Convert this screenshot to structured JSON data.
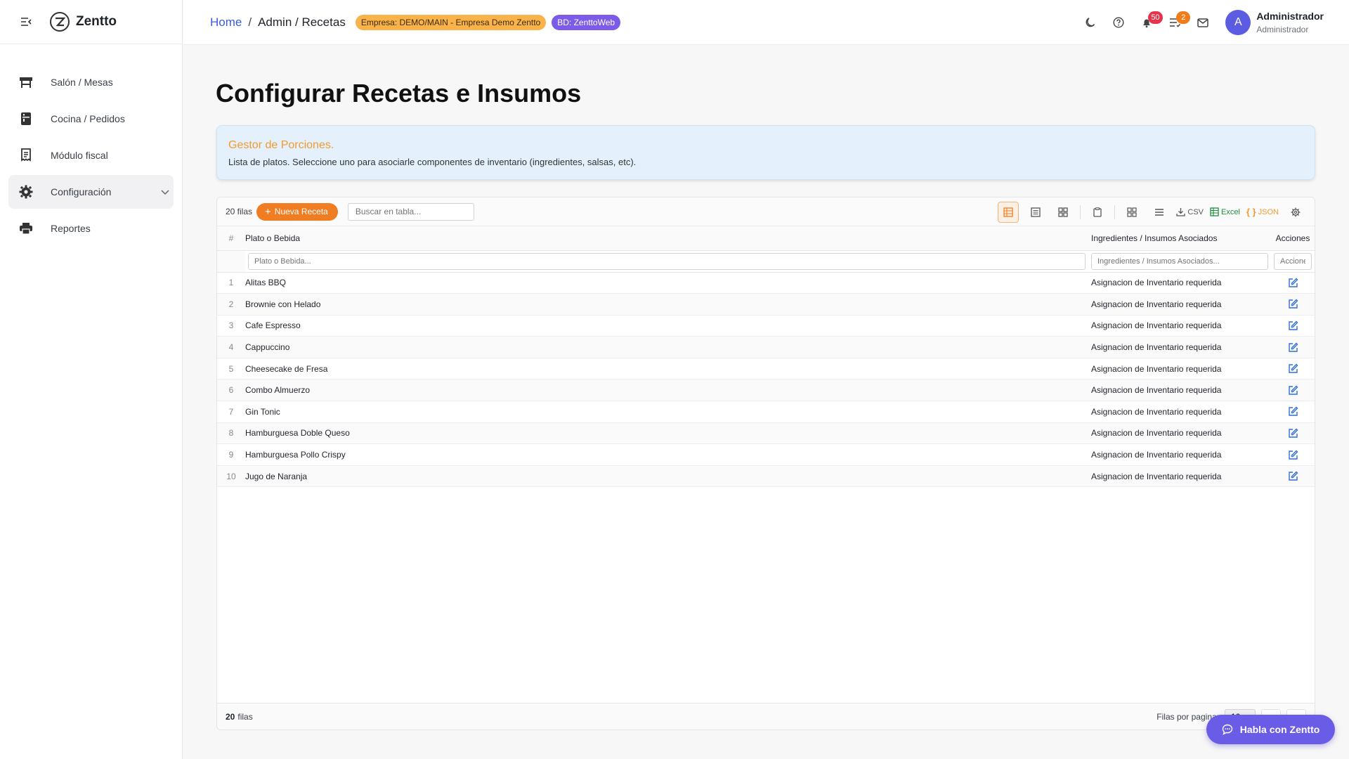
{
  "brand": {
    "name": "Zentto"
  },
  "sidebar": {
    "items": [
      {
        "label": "Salón / Mesas",
        "icon": "table-icon"
      },
      {
        "label": "Cocina / Pedidos",
        "icon": "kitchen-icon"
      },
      {
        "label": "Módulo fiscal",
        "icon": "receipt-icon"
      },
      {
        "label": "Configuración",
        "icon": "gear-icon"
      },
      {
        "label": "Reportes",
        "icon": "printer-icon"
      }
    ]
  },
  "topbar": {
    "breadcrumb": {
      "home": "Home",
      "separator": "/",
      "current": "Admin / Recetas"
    },
    "empresa_chip": "Empresa: DEMO/MAIN - Empresa Demo Zentto",
    "bd_chip": "BD: ZenttoWeb",
    "notifications_count": "50",
    "tasks_count": "2",
    "user": {
      "initial": "A",
      "name": "Administrador",
      "role": "Administrador"
    }
  },
  "page": {
    "title": "Configurar Recetas e Insumos",
    "info": {
      "title": "Gestor de Porciones.",
      "description": "Lista de platos. Seleccione uno para asociarle componentes de inventario (ingredientes, salsas, etc)."
    }
  },
  "grid": {
    "rows_count": "20 filas",
    "new_button": "Nueva Receta",
    "search_placeholder": "Buscar en tabla...",
    "tools": {
      "csv": "CSV",
      "excel": "Excel",
      "json": "JSON"
    },
    "columns": {
      "num": "#",
      "plato": "Plato o Bebida",
      "ingredientes": "Ingredientes / Insumos Asociados",
      "acciones": "Acciones"
    },
    "filters": {
      "plato": "Plato o Bebida...",
      "ingredientes": "Ingredientes / Insumos Asociados...",
      "acciones": "Acciones..."
    },
    "rows": [
      {
        "num": "1",
        "plato": "Alitas BBQ",
        "ingredientes": "Asignacion de Inventario requerida"
      },
      {
        "num": "2",
        "plato": "Brownie con Helado",
        "ingredientes": "Asignacion de Inventario requerida"
      },
      {
        "num": "3",
        "plato": "Cafe Espresso",
        "ingredientes": "Asignacion de Inventario requerida"
      },
      {
        "num": "4",
        "plato": "Cappuccino",
        "ingredientes": "Asignacion de Inventario requerida"
      },
      {
        "num": "5",
        "plato": "Cheesecake de Fresa",
        "ingredientes": "Asignacion de Inventario requerida"
      },
      {
        "num": "6",
        "plato": "Combo Almuerzo",
        "ingredientes": "Asignacion de Inventario requerida"
      },
      {
        "num": "7",
        "plato": "Gin Tonic",
        "ingredientes": "Asignacion de Inventario requerida"
      },
      {
        "num": "8",
        "plato": "Hamburguesa Doble Queso",
        "ingredientes": "Asignacion de Inventario requerida"
      },
      {
        "num": "9",
        "plato": "Hamburguesa Pollo Crispy",
        "ingredientes": "Asignacion de Inventario requerida"
      },
      {
        "num": "10",
        "plato": "Jugo de Naranja",
        "ingredientes": "Asignacion de Inventario requerida"
      }
    ],
    "footer": {
      "count_num": "20",
      "count_label": "filas",
      "per_page_label": "Filas por pagina:",
      "per_page_value": "10"
    }
  },
  "chat": {
    "label": "Habla con Zentto"
  },
  "colors": {
    "accent_orange": "#f07d22",
    "accent_purple": "#6b5ce7",
    "link_blue": "#3b5bdb"
  }
}
